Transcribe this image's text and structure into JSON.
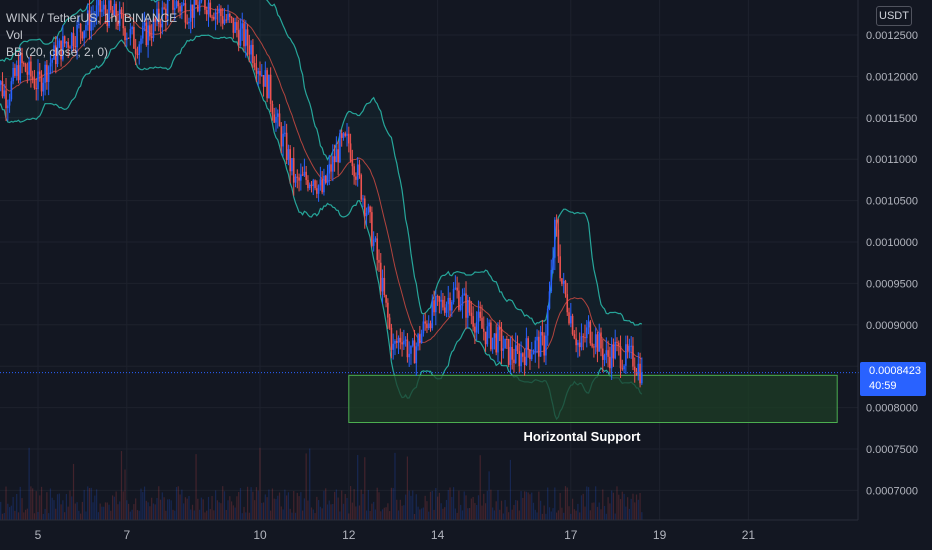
{
  "legend": {
    "symbol": "WINK / TetherUS, 1h, BINANCE",
    "volume": "Vol",
    "indicator": "BB (20, close, 2, 0)"
  },
  "price_scale": {
    "currency": "USDT"
  },
  "last_price": {
    "value": "0.0008423",
    "countdown": "40:59"
  },
  "colors": {
    "background": "#131722",
    "up": "#2962ff",
    "down": "#ef5350",
    "bb_band": "#26a69a",
    "bb_basis": "#b2443e",
    "support_fill": "#1e3d26",
    "support_border": "#4caf50",
    "price_tag": "#2962ff"
  },
  "chart_data": {
    "type": "candlestick",
    "x_ticks": [
      "5",
      "7",
      "10",
      "12",
      "14",
      "17",
      "19",
      "21"
    ],
    "y_ticks": [
      "0.0012500",
      "0.0012000",
      "0.0011500",
      "0.0011000",
      "0.0010500",
      "0.0010000",
      "0.0009500",
      "0.0009000",
      "0.0008500",
      "0.0008000",
      "0.0007500",
      "0.0007000"
    ],
    "ylim": [
      0.00066,
      0.00128
    ],
    "close_path": [
      [
        4.0,
        0.001205
      ],
      [
        4.3,
        0.001175
      ],
      [
        4.6,
        0.001215
      ],
      [
        5.0,
        0.00119
      ],
      [
        5.3,
        0.00122
      ],
      [
        5.6,
        0.00124
      ],
      [
        6.0,
        0.00126
      ],
      [
        6.4,
        0.00128
      ],
      [
        6.8,
        0.00127
      ],
      [
        7.2,
        0.00124
      ],
      [
        7.6,
        0.00126
      ],
      [
        8.0,
        0.00129
      ],
      [
        8.4,
        0.00128
      ],
      [
        8.8,
        0.00129
      ],
      [
        9.2,
        0.00127
      ],
      [
        9.5,
        0.001255
      ],
      [
        9.8,
        0.001235
      ],
      [
        10.0,
        0.00121
      ],
      [
        10.2,
        0.001185
      ],
      [
        10.4,
        0.00114
      ],
      [
        10.6,
        0.00111
      ],
      [
        10.8,
        0.00107
      ],
      [
        11.0,
        0.001075
      ],
      [
        11.2,
        0.00108
      ],
      [
        11.4,
        0.00106
      ],
      [
        11.6,
        0.00109
      ],
      [
        11.8,
        0.001115
      ],
      [
        12.0,
        0.00112
      ],
      [
        12.2,
        0.00108
      ],
      [
        12.4,
        0.00104
      ],
      [
        12.6,
        0.00099
      ],
      [
        12.8,
        0.00093
      ],
      [
        13.0,
        0.00087
      ],
      [
        13.2,
        0.00089
      ],
      [
        13.4,
        0.00086
      ],
      [
        13.6,
        0.000885
      ],
      [
        13.8,
        0.00091
      ],
      [
        14.0,
        0.00092
      ],
      [
        14.2,
        0.00093
      ],
      [
        14.4,
        0.00094
      ],
      [
        14.6,
        0.000925
      ],
      [
        14.8,
        0.00091
      ],
      [
        15.0,
        0.000895
      ],
      [
        15.2,
        0.000885
      ],
      [
        15.4,
        0.00088
      ],
      [
        15.6,
        0.000865
      ],
      [
        15.8,
        0.00086
      ],
      [
        16.0,
        0.00087
      ],
      [
        16.2,
        0.000875
      ],
      [
        16.4,
        0.000875
      ],
      [
        16.55,
        0.00095
      ],
      [
        16.65,
        0.00102
      ],
      [
        16.8,
        0.00095
      ],
      [
        17.0,
        0.00091
      ],
      [
        17.2,
        0.00087
      ],
      [
        17.4,
        0.000895
      ],
      [
        17.6,
        0.00088
      ],
      [
        17.8,
        0.00086
      ],
      [
        18.0,
        0.00087
      ],
      [
        18.2,
        0.00086
      ],
      [
        18.4,
        0.00086
      ],
      [
        18.6,
        0.000842
      ]
    ],
    "last_price": 0.0008423,
    "annotations": [
      {
        "label": "Horizontal Support",
        "y_range": [
          0.000782,
          0.000839
        ],
        "x_range": [
          12.0,
          23.0
        ]
      }
    ]
  }
}
